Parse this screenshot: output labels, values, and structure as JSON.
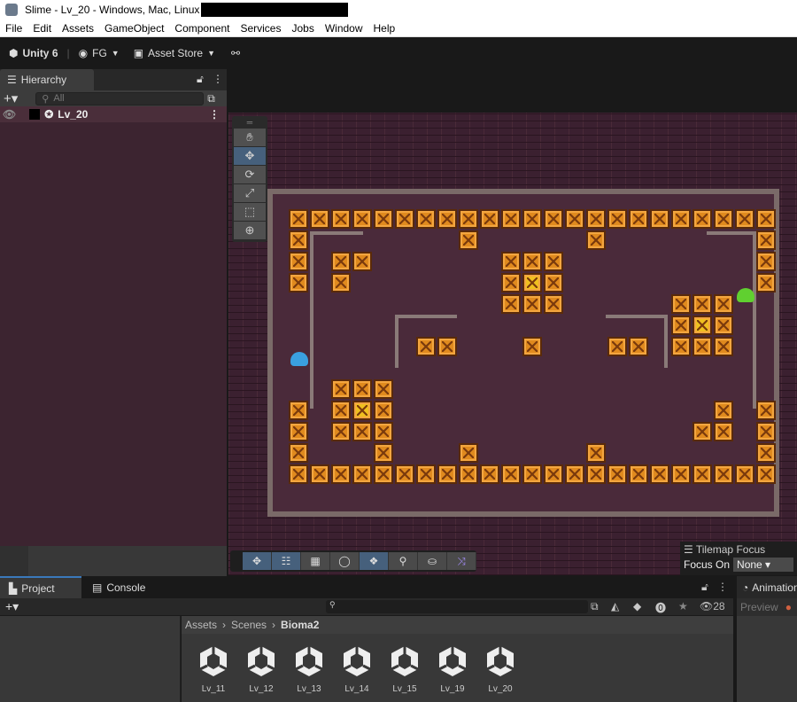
{
  "window": {
    "title": "Slime - Lv_20 - Windows, Mac, Linux"
  },
  "menu": [
    "File",
    "Edit",
    "Assets",
    "GameObject",
    "Component",
    "Services",
    "Jobs",
    "Window",
    "Help"
  ],
  "toolbar": {
    "unity": "Unity 6",
    "account": "FG",
    "asset_store": "Asset Store"
  },
  "hierarchy": {
    "tab": "Hierarchy",
    "search_placeholder": "All",
    "root": "Lv_20"
  },
  "scene": {
    "tilemap_focus_title": "Tilemap Focus",
    "focus_on_label": "Focus On",
    "focus_value": "None"
  },
  "bottom": {
    "tabs": [
      "Project",
      "Console"
    ],
    "animation_tab": "Animation",
    "preview": "Preview",
    "hidden_count": "28"
  },
  "breadcrumb": [
    "Assets",
    "Scenes",
    "Bioma2"
  ],
  "assets": [
    "Lv_11",
    "Lv_12",
    "Lv_13",
    "Lv_14",
    "Lv_15",
    "Lv_19",
    "Lv_20"
  ],
  "colors": {
    "scene_bg": "#3b2030",
    "crate": "#e08a1e",
    "accent": "#46607c"
  }
}
